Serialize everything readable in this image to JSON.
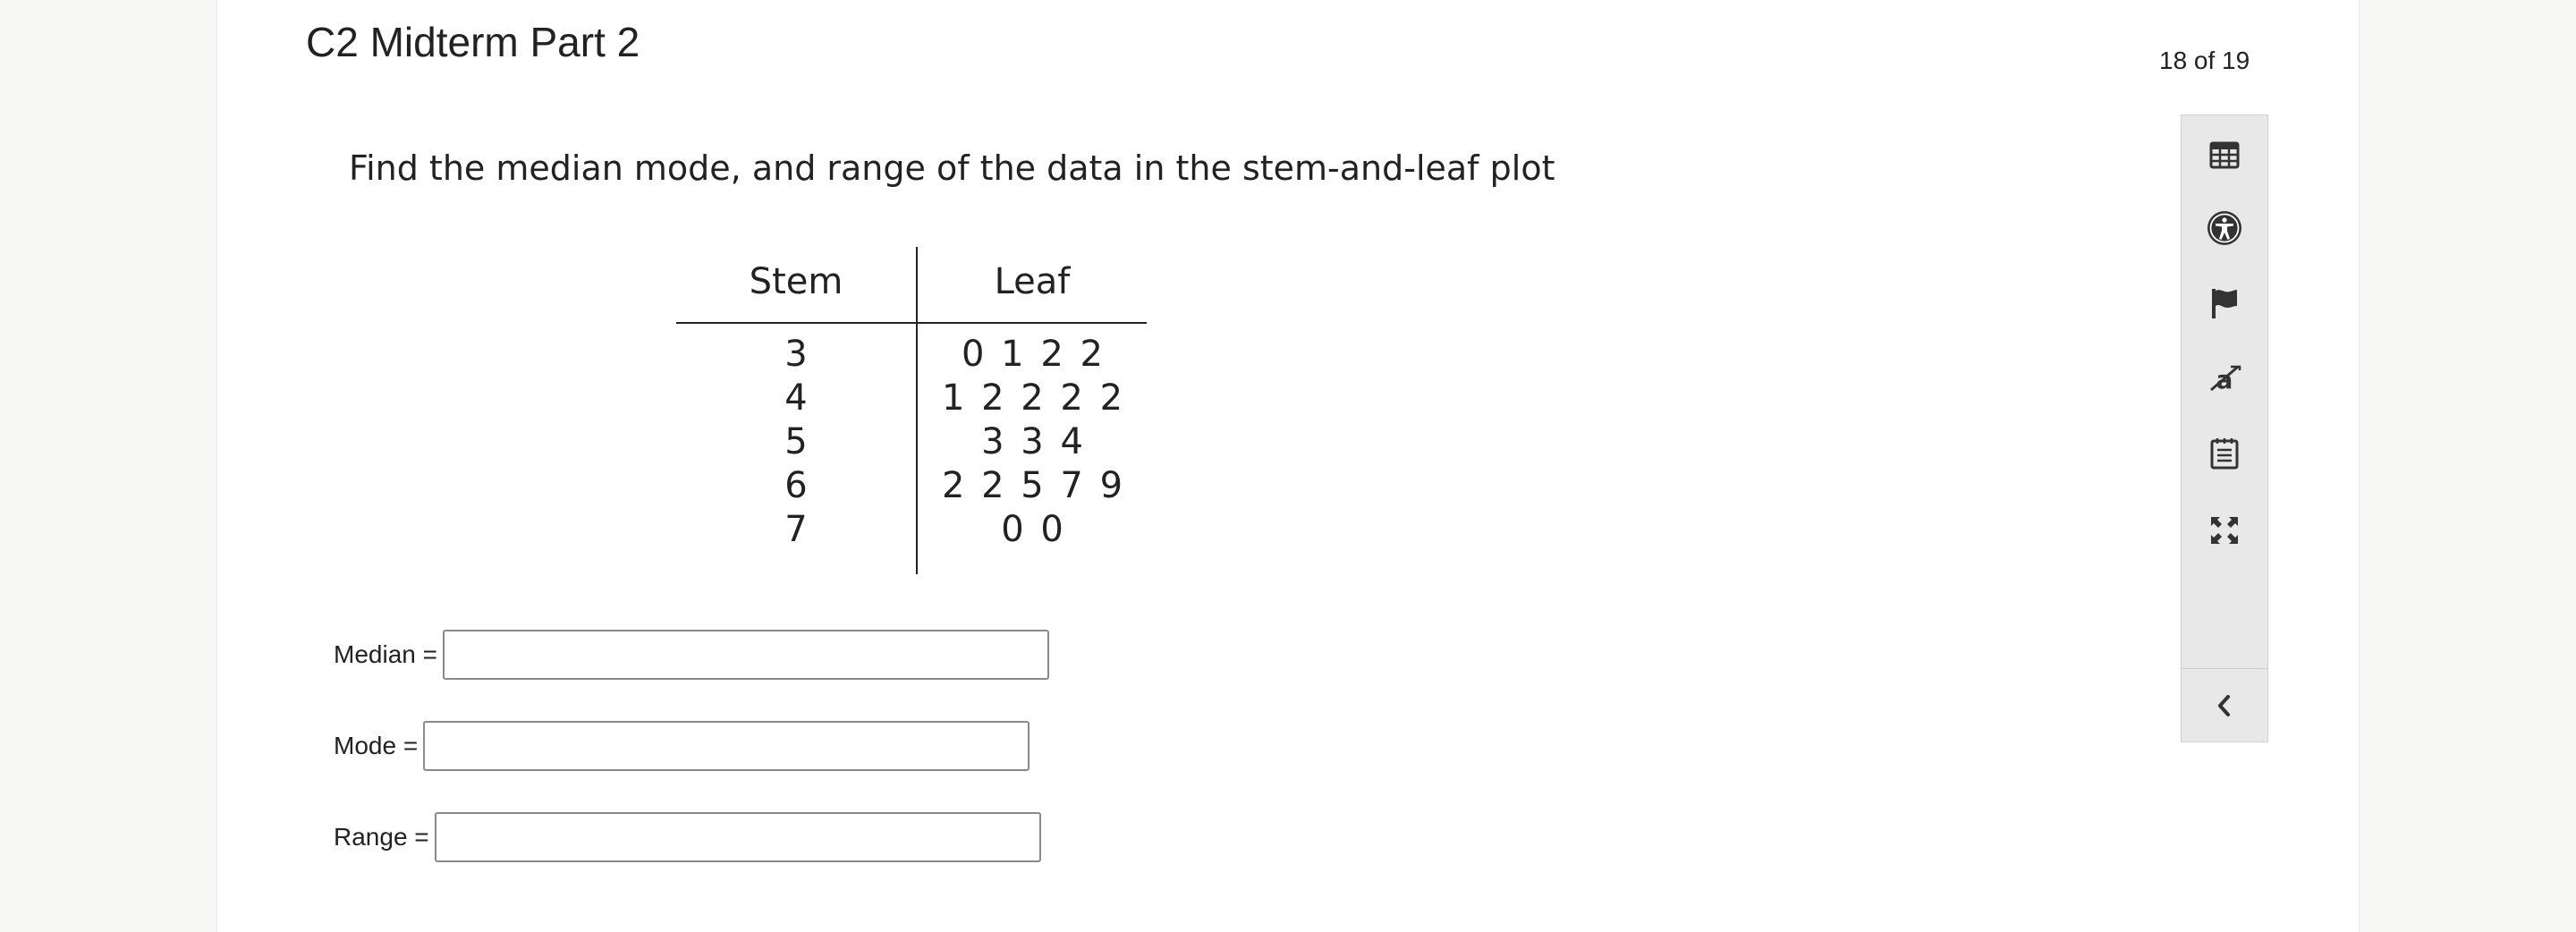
{
  "quiz": {
    "title": "C2 Midterm Part 2",
    "counter": "18 of 19"
  },
  "question": {
    "prompt": "Find the median mode, and range of the data in the stem-and-leaf plot"
  },
  "plot": {
    "stem_header": "Stem",
    "leaf_header": "Leaf",
    "rows": [
      {
        "stem": "3",
        "leaves": "0 1 2 2"
      },
      {
        "stem": "4",
        "leaves": "1 2 2 2 2"
      },
      {
        "stem": "5",
        "leaves": "3 3 4"
      },
      {
        "stem": "6",
        "leaves": "2 2 5 7 9"
      },
      {
        "stem": "7",
        "leaves": "0 0"
      }
    ]
  },
  "answers": {
    "median_label": "Median =",
    "median_value": "",
    "mode_label": "Mode =",
    "mode_value": "",
    "range_label": "Range =",
    "range_value": ""
  },
  "toolbar": {
    "tools": [
      {
        "icon": "calculator-icon"
      },
      {
        "icon": "accessibility-icon"
      },
      {
        "icon": "flag-icon"
      },
      {
        "icon": "eliminator-icon"
      },
      {
        "icon": "notepad-icon"
      },
      {
        "icon": "expand-icon"
      }
    ],
    "collapse_icon": "chevron-left-icon"
  },
  "colors": {
    "background": "#f6f6f5",
    "page": "#ffffff",
    "toolbar": "#e8e8e8",
    "text": "#222222",
    "icon": "#333333"
  }
}
